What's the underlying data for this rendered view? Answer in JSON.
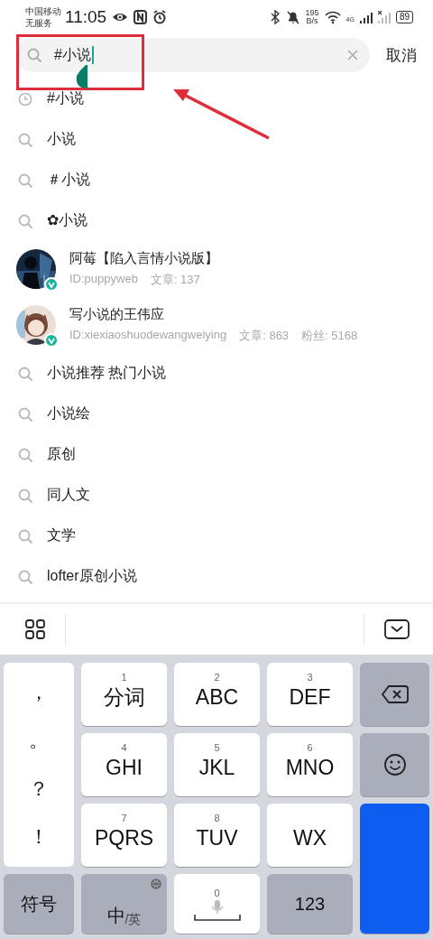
{
  "status_bar": {
    "carrier": "中国移动",
    "carrier_status": "无服务",
    "time": "11:05",
    "net_speed_value": "195",
    "net_speed_unit": "B/s",
    "network_type": "4G",
    "battery": "89"
  },
  "search": {
    "value": "#小说",
    "cancel": "取消"
  },
  "suggestions": [
    {
      "kind": "history",
      "text": "#小说"
    },
    {
      "kind": "query",
      "text": "小说"
    },
    {
      "kind": "query",
      "text": "＃小说"
    },
    {
      "kind": "query",
      "text": "✿小说"
    },
    {
      "kind": "user",
      "name": "阿莓【陷入言情小说版】",
      "id": "ID:puppyweb",
      "stats": [
        "文章: 137"
      ],
      "verified": true
    },
    {
      "kind": "user",
      "name": "写小说的王伟应",
      "id": "ID:xiexiaoshuodewangweiying",
      "stats": [
        "文章: 863",
        "粉丝: 5168"
      ],
      "verified": true
    },
    {
      "kind": "query",
      "text": "小说推荐 热门小说"
    },
    {
      "kind": "query",
      "text": "小说绘"
    },
    {
      "kind": "query",
      "text": "原创"
    },
    {
      "kind": "query",
      "text": "同人文"
    },
    {
      "kind": "query",
      "text": "文学"
    },
    {
      "kind": "query",
      "text": "lofter原创小说"
    }
  ],
  "keyboard": {
    "punctuation": [
      "，",
      "。",
      "？",
      "！"
    ],
    "keys": [
      {
        "kind": "letters",
        "digit": "1",
        "label": "分词"
      },
      {
        "kind": "letters",
        "digit": "2",
        "label": "ABC"
      },
      {
        "kind": "letters",
        "digit": "3",
        "label": "DEF"
      },
      {
        "kind": "backspace"
      },
      {
        "kind": "letters",
        "digit": "4",
        "label": "GHI"
      },
      {
        "kind": "letters",
        "digit": "5",
        "label": "JKL"
      },
      {
        "kind": "letters",
        "digit": "6",
        "label": "MNO"
      },
      {
        "kind": "emoji"
      },
      {
        "kind": "letters",
        "digit": "7",
        "label": "PQRS"
      },
      {
        "kind": "letters",
        "digit": "8",
        "label": "TUV"
      },
      {
        "kind": "letters",
        "label": "WX"
      },
      {
        "kind": "enter"
      },
      {
        "kind": "function",
        "label": "符号"
      },
      {
        "kind": "language",
        "label": "中",
        "sub": "/英"
      },
      {
        "kind": "space",
        "digit": "0"
      },
      {
        "kind": "function",
        "label": "123"
      }
    ]
  }
}
